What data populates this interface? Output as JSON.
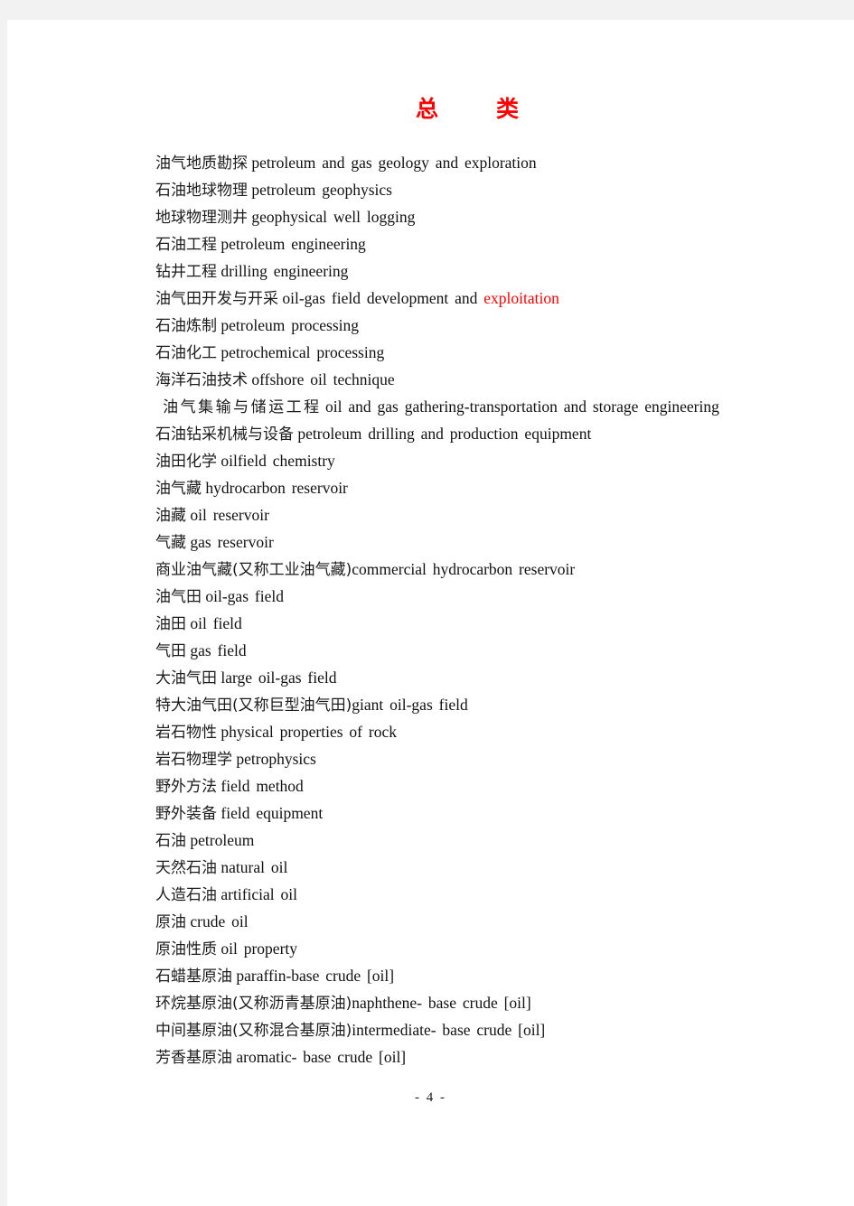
{
  "page": {
    "title_left": "总",
    "title_right": "类",
    "footer": "- 4 -"
  },
  "entries": [
    {
      "cn": "油气地质勘探",
      "en": "petroleum and gas geology and exploration"
    },
    {
      "cn": "石油地球物理",
      "en": "petroleum geophysics"
    },
    {
      "cn": "地球物理测井",
      "en": "geophysical well logging"
    },
    {
      "cn": "石油工程",
      "en": "petroleum engineering"
    },
    {
      "cn": "钻井工程",
      "en": "drilling engineering"
    },
    {
      "cn": "油气田开发与开采",
      "en": "oil-gas field development and ",
      "en_red": "exploitation"
    },
    {
      "cn": "石油炼制",
      "en": "petroleum processing"
    },
    {
      "cn": "石油化工",
      "en": "petrochemical processing"
    },
    {
      "cn": "海洋石油技术",
      "en": "offshore oil technique"
    },
    {
      "cn": "油气集输与储运工程",
      "en": "oil and gas gathering-transportation and storage engineering",
      "wrap": true
    },
    {
      "cn": "石油钻采机械与设备",
      "en": "petroleum drilling and production equipment"
    },
    {
      "cn": "油田化学",
      "en": "oilfield chemistry"
    },
    {
      "cn": "油气藏",
      "en": "hydrocarbon reservoir"
    },
    {
      "cn": "油藏",
      "en": "oil reservoir"
    },
    {
      "cn": "气藏",
      "en": "gas reservoir"
    },
    {
      "cn": "商业油气藏(又称工业油气藏)",
      "en": "commercial hydrocarbon reservoir",
      "tight": true
    },
    {
      "cn": "油气田",
      "en": "oil-gas field"
    },
    {
      "cn": "油田",
      "en": "oil field"
    },
    {
      "cn": "气田",
      "en": "gas field"
    },
    {
      "cn": "大油气田",
      "en": "large oil-gas field"
    },
    {
      "cn": "特大油气田(又称巨型油气田)",
      "en": "giant oil-gas field",
      "tight": true
    },
    {
      "cn": "岩石物性",
      "en": "physical properties of rock"
    },
    {
      "cn": "岩石物理学",
      "en": "petrophysics"
    },
    {
      "cn": "野外方法",
      "en": "field method"
    },
    {
      "cn": "野外装备",
      "en": "field equipment"
    },
    {
      "cn": "石油",
      "en": "petroleum"
    },
    {
      "cn": "天然石油",
      "en": "natural oil"
    },
    {
      "cn": "人造石油",
      "en": "artificial oil"
    },
    {
      "cn": "原油",
      "en": "crude oil"
    },
    {
      "cn": "原油性质",
      "en": "oil property"
    },
    {
      "cn": "石蜡基原油",
      "en": "paraffin-base crude [oil]"
    },
    {
      "cn": "环烷基原油(又称沥青基原油)",
      "en": "naphthene- base crude [oil]",
      "tight": true
    },
    {
      "cn": "中间基原油(又称混合基原油)",
      "en": "intermediate- base crude [oil]",
      "tight": true
    },
    {
      "cn": "芳香基原油",
      "en": "aromatic- base crude [oil]"
    }
  ]
}
